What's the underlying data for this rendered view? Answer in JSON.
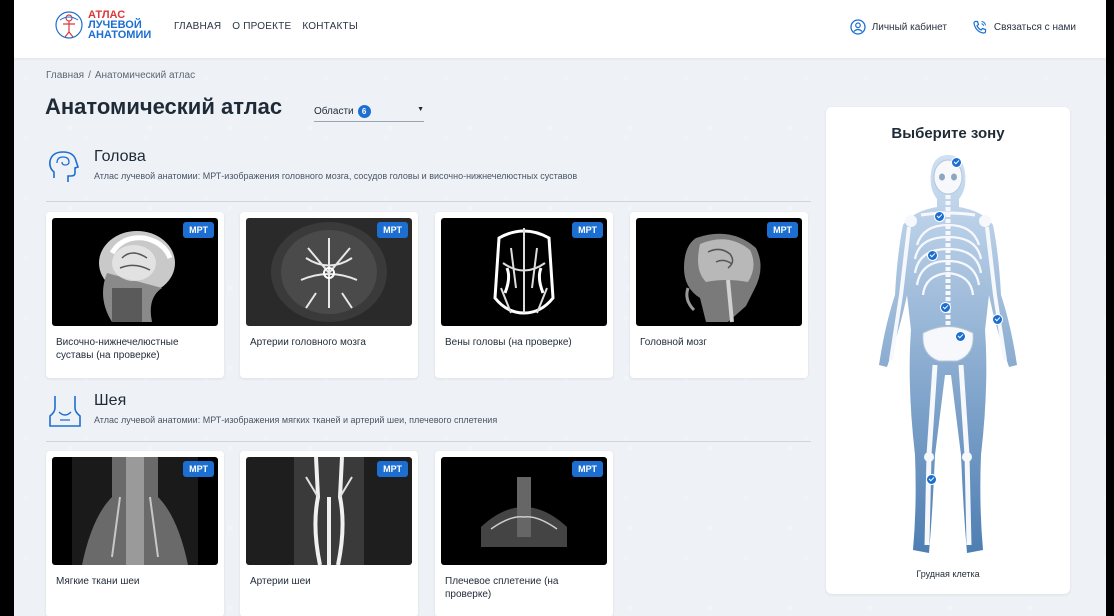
{
  "header": {
    "logo": {
      "line1": "АТЛАС",
      "line2": "ЛУЧЕВОЙ",
      "line3": "АНАТОМИИ"
    },
    "nav": [
      "ГЛАВНАЯ",
      "О ПРОЕКТЕ",
      "КОНТАКТЫ"
    ],
    "account_label": "Личный кабинет",
    "contact_label": "Связаться с нами"
  },
  "breadcrumb": {
    "home": "Главная",
    "sep": "/",
    "current": "Анатомический атлас"
  },
  "page_title": "Анатомический атлас",
  "regions_filter": {
    "label": "Области",
    "count": "6",
    "caret": "▼"
  },
  "sections": [
    {
      "title": "Голова",
      "description": "Атлас лучевой анатомии: МРТ-изображения головного мозга, сосудов головы и височно-нижнечелюстных суставов",
      "cards": [
        {
          "badge": "МРТ",
          "caption": "Височно-нижнечелюстные суставы (на проверке)"
        },
        {
          "badge": "МРТ",
          "caption": "Артерии головного мозга"
        },
        {
          "badge": "МРТ",
          "caption": "Вены головы (на проверке)"
        },
        {
          "badge": "МРТ",
          "caption": "Головной мозг"
        }
      ]
    },
    {
      "title": "Шея",
      "description": "Атлас лучевой анатомии: МРТ-изображения мягких тканей и артерий шеи, плечевого сплетения",
      "cards": [
        {
          "badge": "МРТ",
          "caption": "Мягкие ткани шеи"
        },
        {
          "badge": "МРТ",
          "caption": "Артерии шеи"
        },
        {
          "badge": "МРТ",
          "caption": "Плечевое сплетение (на проверке)"
        }
      ]
    }
  ],
  "zone_panel": {
    "title": "Выберите зону",
    "hover_caption": "Грудная клетка"
  },
  "colors": {
    "accent": "#1c6fd1",
    "logo_red": "#d93a3a",
    "page_bg": "#eef2f6"
  }
}
